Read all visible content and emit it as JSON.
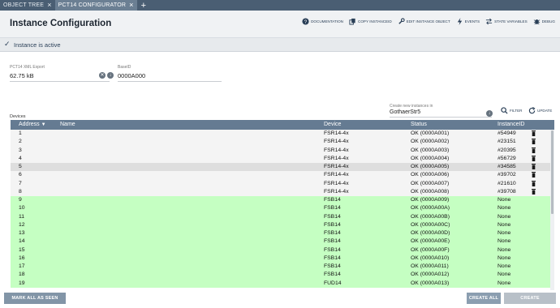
{
  "tabs": [
    {
      "label": "OBJECT TREE",
      "active": false
    },
    {
      "label": "PCT14 CONFIGURATOR",
      "active": true
    }
  ],
  "header": {
    "title": "Instance Configuration",
    "toolbar": {
      "documentation": "DOCUMENTATION",
      "copy_instance_id": "COPY INSTANCEID",
      "edit_instance_object": "EDIT INSTANCE OBJECT",
      "events": "EVENTS",
      "state_variables": "STATE VARIABLES",
      "debug": "DEBUG"
    }
  },
  "status": {
    "text": "Instance is active"
  },
  "export": {
    "label": "PCT14 XML Export",
    "value": "62.75 kB"
  },
  "baseid": {
    "label": "BaseID",
    "value": "0000A000"
  },
  "devices": {
    "label": "Devices"
  },
  "create_new": {
    "label": "Create new instances in",
    "value": "GothaerStr5"
  },
  "actions": {
    "filter": "FILTER",
    "update": "UPDATE"
  },
  "table": {
    "columns": {
      "address": "Address",
      "name": "Name",
      "device": "Device",
      "status": "Status",
      "instance_id": "InstanceID"
    },
    "sort": "descending",
    "rows": [
      {
        "address": "1",
        "name": "",
        "device": "FSR14-4x",
        "status": "OK (0000A001)",
        "instance_id": "#54949",
        "state": "grey",
        "deletable": true
      },
      {
        "address": "2",
        "name": "",
        "device": "FSR14-4x",
        "status": "OK (0000A002)",
        "instance_id": "#23151",
        "state": "grey",
        "deletable": true
      },
      {
        "address": "3",
        "name": "",
        "device": "FSR14-4x",
        "status": "OK (0000A003)",
        "instance_id": "#20395",
        "state": "grey",
        "deletable": true
      },
      {
        "address": "4",
        "name": "",
        "device": "FSR14-4x",
        "status": "OK (0000A004)",
        "instance_id": "#56729",
        "state": "grey",
        "deletable": true
      },
      {
        "address": "5",
        "name": "",
        "device": "FSR14-4x",
        "status": "OK (0000A005)",
        "instance_id": "#34585",
        "state": "sel",
        "deletable": true
      },
      {
        "address": "6",
        "name": "",
        "device": "FSR14-4x",
        "status": "OK (0000A006)",
        "instance_id": "#39702",
        "state": "grey",
        "deletable": true
      },
      {
        "address": "7",
        "name": "",
        "device": "FSR14-4x",
        "status": "OK (0000A007)",
        "instance_id": "#21610",
        "state": "grey",
        "deletable": true
      },
      {
        "address": "8",
        "name": "",
        "device": "FSR14-4x",
        "status": "OK (0000A008)",
        "instance_id": "#39708",
        "state": "grey",
        "deletable": true
      },
      {
        "address": "9",
        "name": "",
        "device": "FSB14",
        "status": "OK (0000A009)",
        "instance_id": "None",
        "state": "green",
        "deletable": false
      },
      {
        "address": "10",
        "name": "",
        "device": "FSB14",
        "status": "OK (0000A00A)",
        "instance_id": "None",
        "state": "green",
        "deletable": false
      },
      {
        "address": "11",
        "name": "",
        "device": "FSB14",
        "status": "OK (0000A00B)",
        "instance_id": "None",
        "state": "green",
        "deletable": false
      },
      {
        "address": "12",
        "name": "",
        "device": "FSB14",
        "status": "OK (0000A00C)",
        "instance_id": "None",
        "state": "green",
        "deletable": false
      },
      {
        "address": "13",
        "name": "",
        "device": "FSB14",
        "status": "OK (0000A00D)",
        "instance_id": "None",
        "state": "green",
        "deletable": false
      },
      {
        "address": "14",
        "name": "",
        "device": "FSB14",
        "status": "OK (0000A00E)",
        "instance_id": "None",
        "state": "green",
        "deletable": false
      },
      {
        "address": "15",
        "name": "",
        "device": "FSB14",
        "status": "OK (0000A00F)",
        "instance_id": "None",
        "state": "green",
        "deletable": false
      },
      {
        "address": "16",
        "name": "",
        "device": "FSB14",
        "status": "OK (0000A010)",
        "instance_id": "None",
        "state": "green",
        "deletable": false
      },
      {
        "address": "17",
        "name": "",
        "device": "FSB14",
        "status": "OK (0000A011)",
        "instance_id": "None",
        "state": "green",
        "deletable": false
      },
      {
        "address": "18",
        "name": "",
        "device": "FSB14",
        "status": "OK (0000A012)",
        "instance_id": "None",
        "state": "green",
        "deletable": false
      },
      {
        "address": "19",
        "name": "",
        "device": "FUD14",
        "status": "OK (0000A013)",
        "instance_id": "None",
        "state": "green",
        "deletable": false
      }
    ]
  },
  "footer": {
    "mark_all_seen": "MARK ALL AS SEEN",
    "create_all": "CREATE ALL",
    "create": "CREATE"
  },
  "colors": {
    "tabbar": "#4a5e73",
    "table_header": "#657b92",
    "new_row": "#c5ffc2",
    "accent": "#2a3f57"
  }
}
